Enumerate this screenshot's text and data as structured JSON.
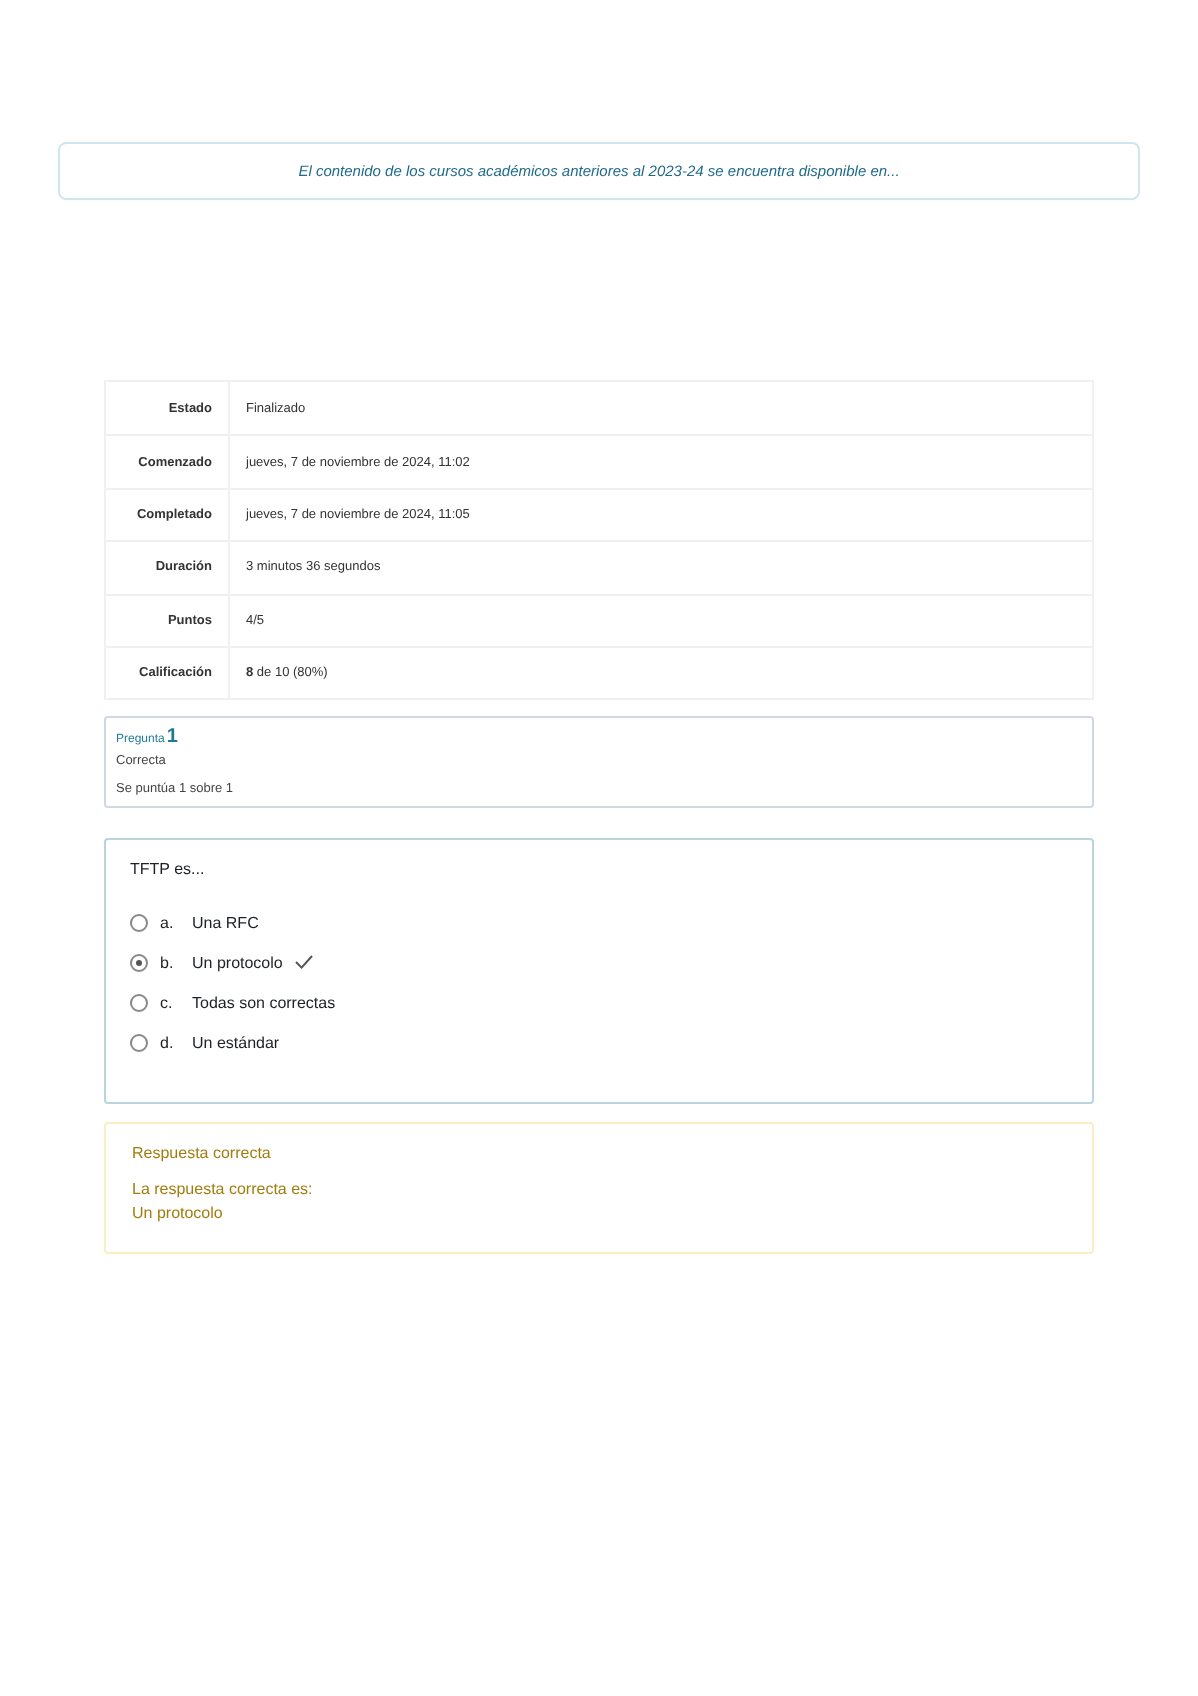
{
  "notice": "El contenido de los cursos académicos anteriores al 2023-24 se encuentra disponible en...",
  "summary": [
    {
      "label": "Estado",
      "value": "Finalizado"
    },
    {
      "label": "Comenzado",
      "value": "jueves, 7 de noviembre de 2024, 11:02"
    },
    {
      "label": "Completado",
      "value": "jueves, 7 de noviembre de 2024, 11:05"
    },
    {
      "label": "Duración",
      "value": "3 minutos 36 segundos"
    },
    {
      "label": "Puntos",
      "value": "4/5"
    },
    {
      "label": "Calificación",
      "value": "**8** de 10 (80%)"
    }
  ],
  "question_info": {
    "label": "Pregunta",
    "number": "1",
    "state": "Correcta",
    "grade": "Se puntúa 1 sobre 1"
  },
  "question": {
    "text": "TFTP es...",
    "options": [
      {
        "letter": "a.",
        "text": "Una RFC",
        "selected": false,
        "correct": false
      },
      {
        "letter": "b.",
        "text": "Un protocolo",
        "selected": true,
        "correct": true
      },
      {
        "letter": "c.",
        "text": "Todas son correctas",
        "selected": false,
        "correct": false
      },
      {
        "letter": "d.",
        "text": "Un estándar",
        "selected": false,
        "correct": false
      }
    ]
  },
  "feedback": {
    "title": "Respuesta correcta",
    "lines": [
      "La respuesta correcta es:",
      "Un protocolo"
    ]
  }
}
